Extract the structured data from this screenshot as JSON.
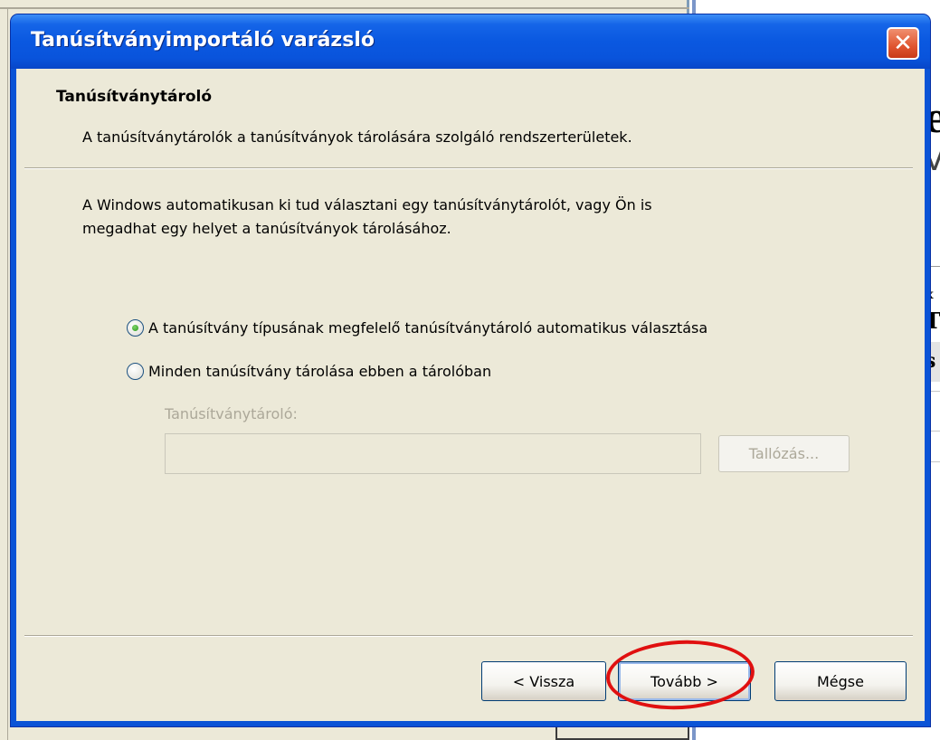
{
  "dialog": {
    "title": "Tanúsítványimportáló varázsló",
    "close_label": "✕"
  },
  "header": {
    "title": "Tanúsítványtároló",
    "description": "A tanúsítványtárolók a tanúsítványok tárolására szolgáló rendszerterületek."
  },
  "body": {
    "intro_line1": "A Windows automatikusan ki tud választani egy tanúsítványtárolót, vagy Ön is",
    "intro_line2": "megadhat egy helyet a tanúsítványok tárolásához.",
    "options": [
      {
        "label": "A tanúsítvány típusának megfelelő tanúsítványtároló automatikus választása",
        "selected": true
      },
      {
        "label": "Minden tanúsítvány tárolása ebben a tárolóban",
        "selected": false
      }
    ],
    "store_label": "Tanúsítványtároló:",
    "store_value": "",
    "browse_label": "Tallózás..."
  },
  "footer": {
    "back_label": "< Vissza",
    "next_label": "Tovább >",
    "cancel_label": "Mégse"
  },
  "background": {
    "frag_e": "e",
    "frag_v": "V",
    "frag_x": "x",
    "frag_t": "T",
    "frag_s": "s"
  },
  "colors": {
    "titlebar": "#0a58e0",
    "client": "#ece9d8",
    "highlight": "#e01010"
  }
}
